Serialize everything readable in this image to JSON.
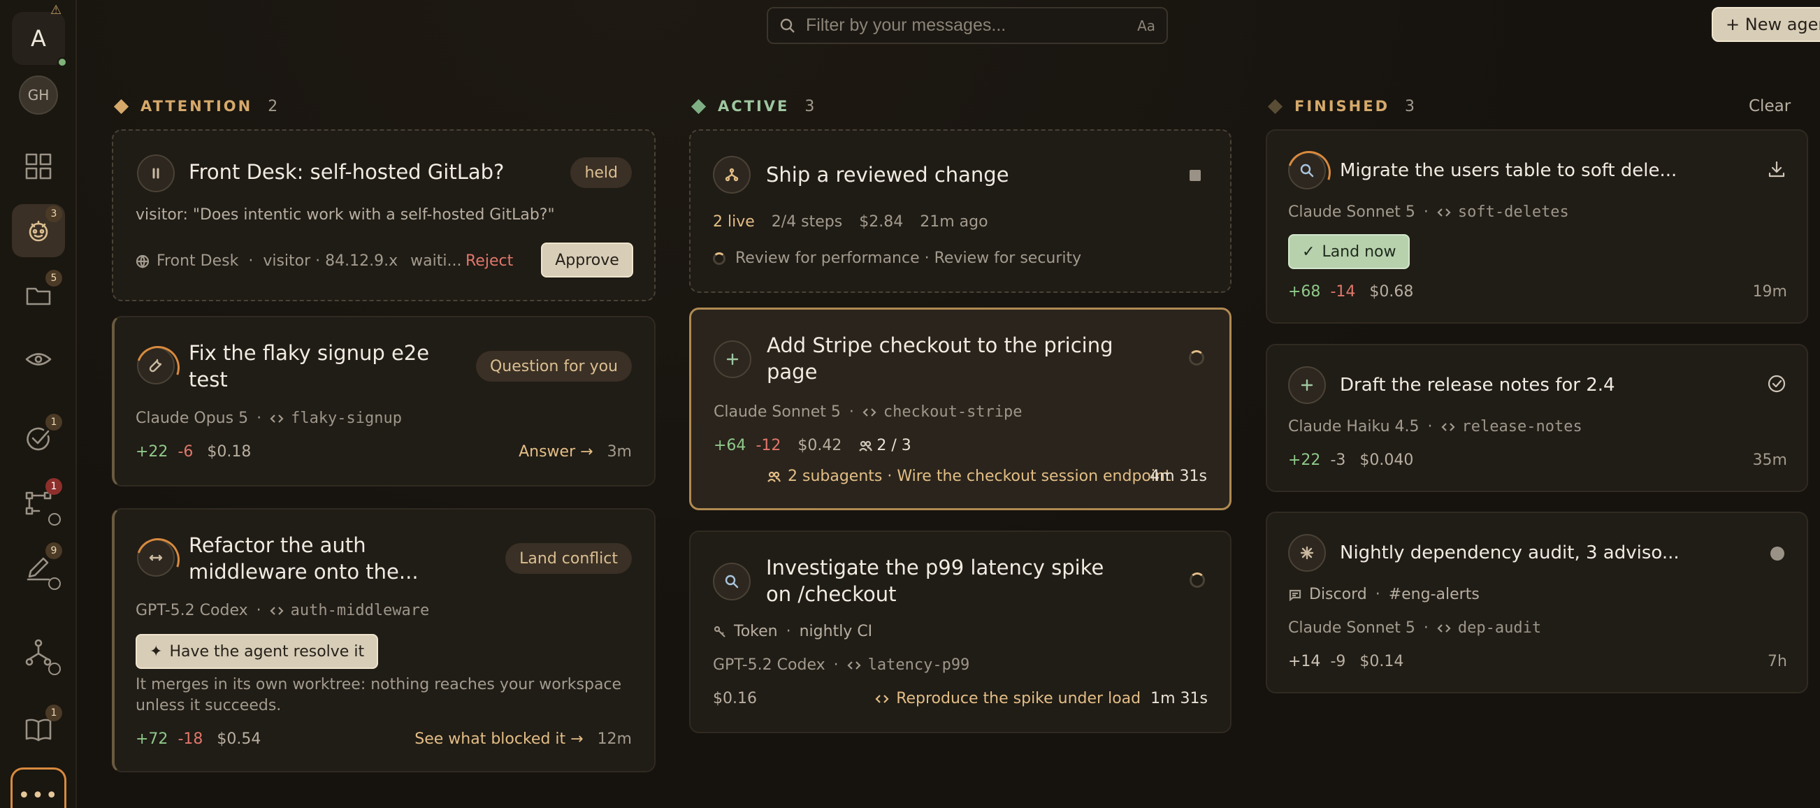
{
  "rail": {
    "user_initial": "A",
    "gh_label": "GH",
    "badges": {
      "agents": "3",
      "folder": "5",
      "checks": "1",
      "flow": "1",
      "edit": "9",
      "book": "1"
    }
  },
  "search": {
    "placeholder": "Filter by your messages...",
    "case_toggle": "Aa"
  },
  "header": {
    "new_agent_label": "+ New agent"
  },
  "columns": {
    "attention": {
      "label": "ATTENTION",
      "count": "2",
      "color": "#d6a96a"
    },
    "active": {
      "label": "ACTIVE",
      "count": "3",
      "color": "#7fae84"
    },
    "finished": {
      "label": "FINISHED",
      "count": "3",
      "color": "#7a6a4c",
      "clear_label": "Clear"
    }
  },
  "attention_cards": [
    {
      "title": "Front Desk: self-hosted GitLab?",
      "status": "held",
      "message": "visitor: \"Does intentic work with a self-hosted GitLab?\"",
      "source": "Front Desk",
      "visitor": "visitor · 84.12.9.x",
      "waiting": "waiti...",
      "reject_label": "Reject",
      "approve_label": "Approve"
    },
    {
      "title": "Fix the flaky signup e2e test",
      "status": "Question for you",
      "model": "Claude Opus 5",
      "branch": "flaky-signup",
      "added": "+22",
      "removed": "-6",
      "cost": "$0.18",
      "action": "Answer →",
      "age": "3m"
    },
    {
      "title": "Refactor the auth middleware onto the...",
      "status": "Land conflict",
      "model": "GPT-5.2 Codex",
      "branch": "auth-middleware",
      "resolve_label": "Have the agent resolve it",
      "note": "It merges in its own worktree: nothing reaches your workspace unless it succeeds.",
      "added": "+72",
      "removed": "-18",
      "cost": "$0.54",
      "action": "See what blocked it →",
      "age": "12m"
    }
  ],
  "active_cards": [
    {
      "title": "Ship a reviewed change",
      "live": "2 live",
      "steps": "2/4 steps",
      "cost": "$2.84",
      "age": "21m ago",
      "activity": "Review for performance · Review for security"
    },
    {
      "title": "Add Stripe checkout to the pricing page",
      "model": "Claude Sonnet 5",
      "branch": "checkout-stripe",
      "added": "+64",
      "removed": "-12",
      "cost": "$0.42",
      "subagent_count": "2 / 3",
      "activity": "2 subagents · Wire the checkout session endpoint",
      "elapsed": "4m 31s"
    },
    {
      "title": "Investigate the p99 latency spike on /checkout",
      "trigger": "Token",
      "trigger_name": "nightly CI",
      "model": "GPT-5.2 Codex",
      "branch": "latency-p99",
      "cost": "$0.16",
      "activity": "Reproduce the spike under load",
      "elapsed": "1m 31s"
    }
  ],
  "finished_cards": [
    {
      "title": "Migrate the users table to soft dele...",
      "model": "Claude Sonnet 5",
      "branch": "soft-deletes",
      "land_label": "Land now",
      "added": "+68",
      "removed": "-14",
      "cost": "$0.68",
      "age": "19m"
    },
    {
      "title": "Draft the release notes for 2.4",
      "model": "Claude Haiku 4.5",
      "branch": "release-notes",
      "added": "+22",
      "removed": "-3",
      "cost": "$0.040",
      "age": "35m"
    },
    {
      "title": "Nightly dependency audit, 3 adviso...",
      "source": "Discord",
      "channel": "#eng-alerts",
      "model": "Claude Sonnet 5",
      "branch": "dep-audit",
      "added": "+14",
      "removed": "-9",
      "cost": "$0.14",
      "age": "7h"
    }
  ]
}
